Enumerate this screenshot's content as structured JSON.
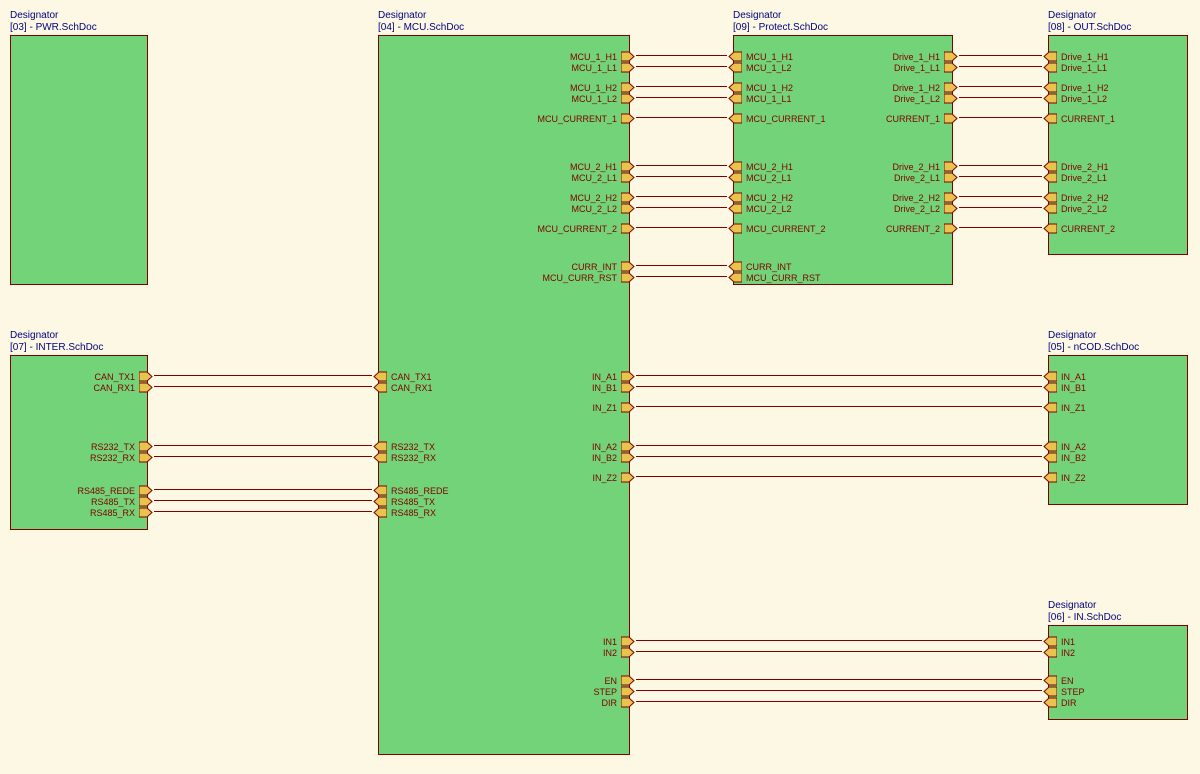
{
  "blocks": {
    "pwr": {
      "designator": "Designator",
      "sub": "[03] - PWR.SchDoc"
    },
    "mcu": {
      "designator": "Designator",
      "sub": "[04] - MCU.SchDoc"
    },
    "protect": {
      "designator": "Designator",
      "sub": "[09] - Protect.SchDoc"
    },
    "out": {
      "designator": "Designator",
      "sub": "[08] - OUT.SchDoc"
    },
    "inter": {
      "designator": "Designator",
      "sub": "[07] - INTER.SchDoc"
    },
    "ncod": {
      "designator": "Designator",
      "sub": "[05] - nCOD.SchDoc"
    },
    "in": {
      "designator": "Designator",
      "sub": "[06] - IN.SchDoc"
    }
  },
  "ports": {
    "mcu_right": [
      "MCU_1_H1",
      "MCU_1_L1",
      "MCU_1_H2",
      "MCU_1_L2",
      "MCU_CURRENT_1",
      "MCU_2_H1",
      "MCU_2_L1",
      "MCU_2_H2",
      "MCU_2_L2",
      "MCU_CURRENT_2",
      "CURR_INT",
      "MCU_CURR_RST",
      "IN_A1",
      "IN_B1",
      "IN_Z1",
      "IN_A2",
      "IN_B2",
      "IN_Z2",
      "IN1",
      "IN2",
      "EN",
      "STEP",
      "DIR"
    ],
    "mcu_left": [
      "CAN_TX1",
      "CAN_RX1",
      "RS232_TX",
      "RS232_RX",
      "RS485_REDE",
      "RS485_TX",
      "RS485_RX"
    ],
    "inter_right": [
      "CAN_TX1",
      "CAN_RX1",
      "RS232_TX",
      "RS232_RX",
      "RS485_REDE",
      "RS485_TX",
      "RS485_RX"
    ],
    "protect_left": [
      "MCU_1_H1",
      "MCU_1_L2",
      "MCU_1_H2",
      "MCU_1_L1",
      "MCU_CURRENT_1",
      "MCU_2_H1",
      "MCU_2_L1",
      "MCU_2_H2",
      "MCU_2_L2",
      "MCU_CURRENT_2",
      "CURR_INT",
      "MCU_CURR_RST"
    ],
    "protect_right": [
      "Drive_1_H1",
      "Drive_1_L1",
      "Drive_1_H2",
      "Drive_1_L2",
      "CURRENT_1",
      "Drive_2_H1",
      "Drive_2_L1",
      "Drive_2_H2",
      "Drive_2_L2",
      "CURRENT_2"
    ],
    "out_left": [
      "Drive_1_H1",
      "Drive_1_L1",
      "Drive_1_H2",
      "Drive_1_L2",
      "CURRENT_1",
      "Drive_2_H1",
      "Drive_2_L1",
      "Drive_2_H2",
      "Drive_2_L2",
      "CURRENT_2"
    ],
    "ncod_left": [
      "IN_A1",
      "IN_B1",
      "IN_Z1",
      "IN_A2",
      "IN_B2",
      "IN_Z2"
    ],
    "in_left": [
      "IN1",
      "IN2",
      "EN",
      "STEP",
      "DIR"
    ]
  },
  "layout": {
    "mcu_right_y": [
      50,
      61,
      81,
      92,
      112,
      160,
      171,
      191,
      202,
      222,
      260,
      271,
      370,
      381,
      401,
      440,
      451,
      471,
      635,
      646,
      674,
      685,
      696
    ],
    "protect_y": [
      50,
      61,
      81,
      92,
      112,
      160,
      171,
      191,
      202,
      222,
      260,
      271
    ],
    "out_y": [
      50,
      61,
      81,
      92,
      112,
      160,
      171,
      191,
      202,
      222
    ],
    "inter_y": [
      370,
      381,
      440,
      451,
      484,
      495,
      506
    ],
    "ncod_y": [
      370,
      381,
      401,
      440,
      451,
      471
    ],
    "in_y": [
      635,
      646,
      674,
      685,
      696
    ]
  }
}
